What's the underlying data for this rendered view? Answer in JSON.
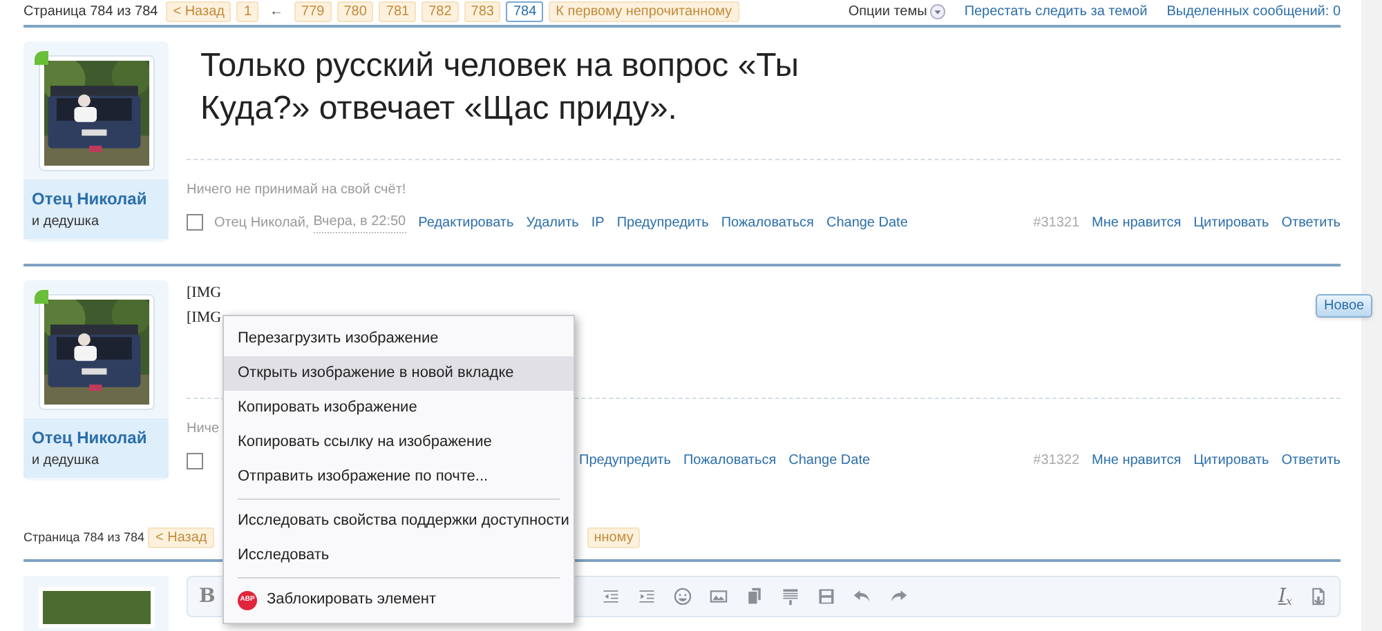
{
  "top_nav": {
    "page_label": "Страница 784 из 784",
    "prev": "< Назад",
    "pages": [
      {
        "kind": "page",
        "label": "1",
        "selected": false
      },
      {
        "kind": "gap",
        "label": "←"
      },
      {
        "kind": "page",
        "label": "779",
        "selected": false
      },
      {
        "kind": "page",
        "label": "780",
        "selected": false
      },
      {
        "kind": "page",
        "label": "781",
        "selected": false
      },
      {
        "kind": "page",
        "label": "782",
        "selected": false
      },
      {
        "kind": "page",
        "label": "783",
        "selected": false
      },
      {
        "kind": "page",
        "label": "784",
        "selected": true
      }
    ],
    "jump": "К первому непрочитанному"
  },
  "thread_tools": {
    "options": "Опции темы",
    "unwatch": "Перестать следить за темой",
    "selected_messages": "Выделенных сообщений: 0"
  },
  "posts": [
    {
      "author": "Отец Николай",
      "title": "и дедушка",
      "body": {
        "kind": "big",
        "text": "Только русский человек на вопрос «Ты Куда?» отвечает «Щас приду»."
      },
      "signature": "Ничего не принимай на свой счёт!",
      "checked": false,
      "meta_author": "Отец Николай,",
      "meta_date": "Вчера, в 22:50",
      "actions": [
        "Редактировать",
        "Удалить",
        "IP",
        "Предупредить",
        "Пожаловаться",
        "Change Date"
      ],
      "number": "#31321",
      "right_actions": [
        "Мне нравится",
        "Цитировать",
        "Ответить"
      ]
    },
    {
      "author": "Отец Николай",
      "title": "и дедушка",
      "body": {
        "kind": "lines",
        "lines": [
          "[IMG",
          "[IMG"
        ]
      },
      "signature": "Ниче",
      "checked": false,
      "actions": [
        "Предупредить",
        "Пожаловаться",
        "Change Date"
      ],
      "number": "#31322",
      "right_actions": [
        "Мне нравится",
        "Цитировать",
        "Ответить"
      ],
      "badge": "Новое"
    }
  ],
  "editor_toolbar": {
    "bold": "B",
    "clear_format": "I",
    "clear_format_sub": "x"
  },
  "bottom_nav": {
    "page_label": "Страница 784 из 784",
    "prev": "< Назад",
    "tail": "нному"
  },
  "context_menu": [
    {
      "kind": "item",
      "label": "Перезагрузить изображение",
      "selected": false
    },
    {
      "kind": "item",
      "label": "Открыть изображение в новой вкладке",
      "selected": true
    },
    {
      "kind": "item",
      "label": "Копировать изображение",
      "selected": false
    },
    {
      "kind": "item",
      "label": "Копировать ссылку на изображение",
      "selected": false
    },
    {
      "kind": "item",
      "label": "Отправить изображение по почте...",
      "selected": false
    },
    {
      "kind": "separator"
    },
    {
      "kind": "item",
      "label": "Исследовать свойства поддержки доступности",
      "selected": false
    },
    {
      "kind": "item",
      "label": "Исследовать",
      "selected": false
    },
    {
      "kind": "separator"
    },
    {
      "kind": "item",
      "label": "Заблокировать элемент",
      "selected": false,
      "icon": "ABP"
    }
  ]
}
